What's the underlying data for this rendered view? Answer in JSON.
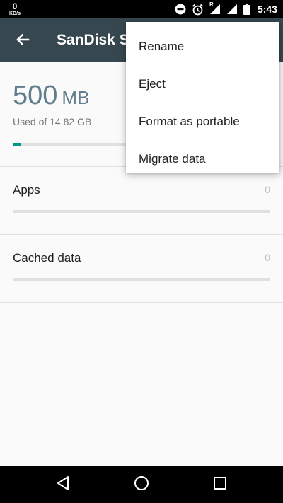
{
  "status_bar": {
    "net_speed": "0",
    "net_speed_unit": "KB/s",
    "roaming_indicator": "R",
    "time": "5:43",
    "icons": [
      "do-not-disturb-icon",
      "alarm-icon",
      "signal-icon",
      "signal-icon",
      "battery-icon"
    ]
  },
  "toolbar": {
    "title": "SanDisk SD card",
    "back_icon": "arrow-back-icon"
  },
  "summary": {
    "used_value": "500",
    "used_unit": "MB",
    "used_of": "Used of 14.82 GB",
    "progress_fraction": 0.033
  },
  "rows": [
    {
      "label": "Apps",
      "value": "0"
    },
    {
      "label": "Cached data",
      "value": "0"
    }
  ],
  "menu": {
    "items": [
      {
        "label": "Rename"
      },
      {
        "label": "Eject"
      },
      {
        "label": "Format as portable"
      },
      {
        "label": "Migrate data"
      }
    ]
  },
  "nav": {
    "icons": [
      "back-triangle-icon",
      "home-circle-icon",
      "recents-square-icon"
    ]
  },
  "colors": {
    "toolbar": "#37474f",
    "accent": "#009688",
    "amount_text": "#607d8b"
  }
}
